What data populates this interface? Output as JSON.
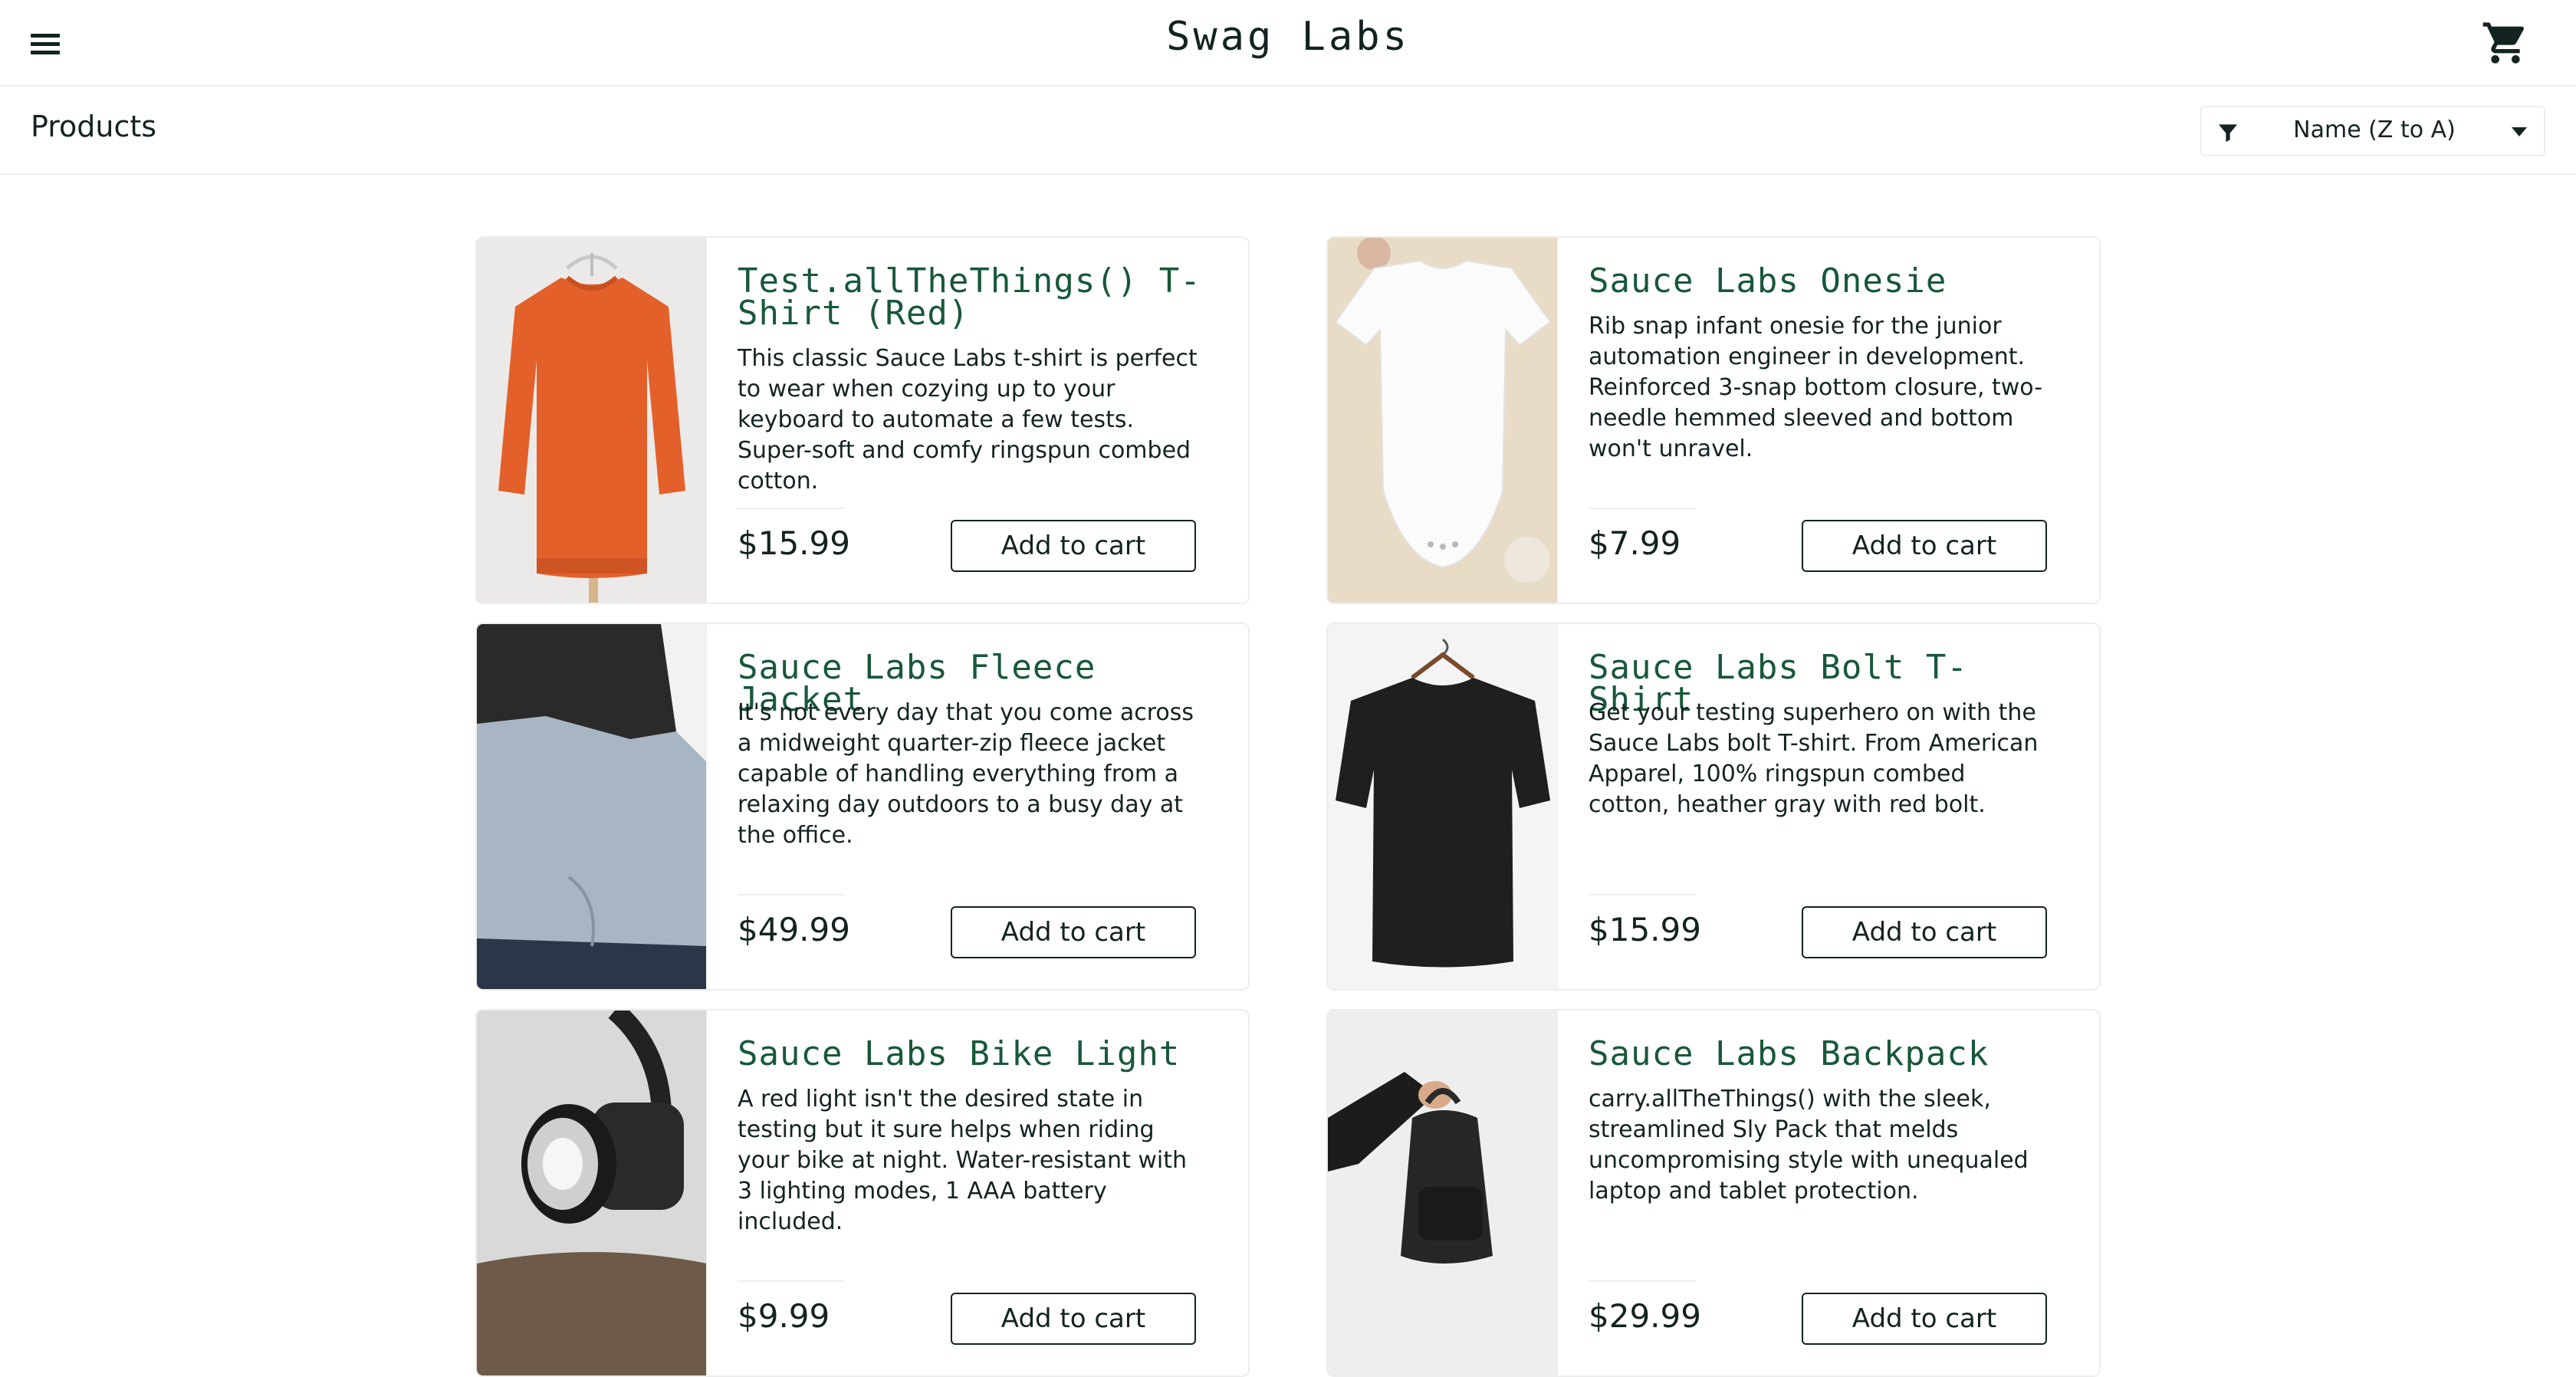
{
  "app": {
    "title": "Swag Labs"
  },
  "header": {
    "menu_icon": "hamburger-menu-icon",
    "cart_icon": "shopping-cart-icon"
  },
  "sub_header": {
    "title": "Products",
    "sort": {
      "icon": "filter-icon",
      "selected": "Name (Z to A)"
    }
  },
  "items": [
    {
      "name": "Test.allTheThings() T-Shirt (Red)",
      "name_lines": [
        "Test.allTheThings() T-",
        "Shirt (Red)"
      ],
      "description": "This classic Sauce Labs t-shirt is perfect to wear when cozying up to your keyboard to automate a few tests. Super-soft and comfy ringspun combed cotton.",
      "price": "$15.99",
      "button": "Add to cart",
      "image": "red-sweatshirt"
    },
    {
      "name": "Sauce Labs Onesie",
      "description": "Rib snap infant onesie for the junior automation engineer in development. Reinforced 3-snap bottom closure, two-needle hemmed sleeved and bottom won't unravel.",
      "price": "$7.99",
      "button": "Add to cart",
      "image": "white-onesie"
    },
    {
      "name": "Sauce Labs Fleece Jacket",
      "description": "It's not every day that you come across a midweight quarter-zip fleece jacket capable of handling everything from a relaxing day outdoors to a busy day at the office.",
      "price": "$49.99",
      "button": "Add to cart",
      "image": "fleece-jacket"
    },
    {
      "name": "Sauce Labs Bolt T-Shirt",
      "description": "Get your testing superhero on with the Sauce Labs bolt T-shirt. From American Apparel, 100% ringspun combed cotton, heather gray with red bolt.",
      "price": "$15.99",
      "button": "Add to cart",
      "image": "black-tshirt"
    },
    {
      "name": "Sauce Labs Bike Light",
      "description": "A red light isn't the desired state in testing but it sure helps when riding your bike at night. Water-resistant with 3 lighting modes, 1 AAA battery included.",
      "price": "$9.99",
      "button": "Add to cart",
      "image": "bike-light"
    },
    {
      "name": "Sauce Labs Backpack",
      "description": "carry.allTheThings() with the sleek, streamlined Sly Pack that melds uncompromising style with unequaled laptop and tablet protection.",
      "price": "$29.99",
      "button": "Add to cart",
      "image": "black-backpack"
    }
  ]
}
